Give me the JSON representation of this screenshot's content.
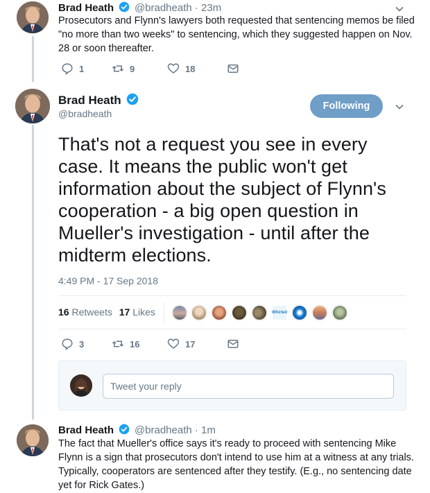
{
  "tweet1": {
    "name": "Brad Heath",
    "handle_time": "@bradheath · 23m",
    "text": "Prosecutors and Flynn's lawyers both requested that sentencing memos be filed \"no more than two weeks\" to sentencing, which they suggested happen on Nov. 28 or soon thereafter.",
    "replies": "1",
    "retweets": "9",
    "likes": "18"
  },
  "main": {
    "name": "Brad Heath",
    "handle": "@bradheath",
    "follow_label": "Following",
    "text": "That's not a request you see in every case. It means the public won't get information about the subject of Flynn's cooperation - a big open question in Mueller's investigation - until after the midterm elections.",
    "timestamp": "4:49 PM - 17 Sep 2018",
    "retweet_count": "16",
    "retweet_label": "Retweets",
    "like_count": "17",
    "like_label": "Likes",
    "replies": "3",
    "retweets": "16",
    "likes": "17",
    "liker_badge": "Whirled"
  },
  "reply": {
    "placeholder": "Tweet your reply"
  },
  "tweet3": {
    "name": "Brad Heath",
    "handle_time": "@bradheath · 1m",
    "text": "The fact that Mueller's office says it's ready to proceed with sentencing Mike Flynn is a sign that prosecutors don't intend to use him at a witness at any trials. Typically, cooperators are sentenced after they testify. (E.g., no sentencing date yet for Rick Gates.)"
  },
  "colors": {
    "verified": "#1da1f2",
    "follow_bg": "#6f9ec7",
    "muted": "#657786"
  }
}
